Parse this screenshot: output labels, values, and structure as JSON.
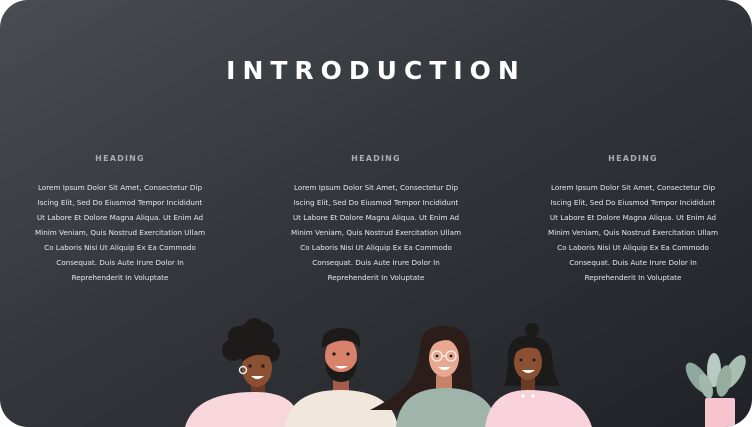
{
  "slide": {
    "title": "INTRODUCTION",
    "columns": [
      {
        "heading": "HEADING",
        "lines": [
          "Lorem Ipsum Dolor Sit Amet, Consectetur Dip",
          "Iscing Elit, Sed Do Eiusmod Tempor Incididunt",
          "Ut Labore Et Dolore Magna Aliqua. Ut Enim Ad",
          "Minim Veniam, Quis Nostrud Exercitation Ullam",
          "Co Laboris Nisi Ut Aliquip Ex Ea Commodo",
          "Consequat. Duis Aute Irure Dolor In",
          "Reprehenderit In Voluptate"
        ]
      },
      {
        "heading": "HEADING",
        "lines": [
          "Lorem Ipsum Dolor Sit Amet, Consectetur Dip",
          "Iscing Elit, Sed Do Eiusmod Tempor Incididunt",
          "Ut Labore Et Dolore Magna Aliqua. Ut Enim Ad",
          "Minim Veniam, Quis Nostrud Exercitation Ullam",
          "Co Laboris Nisi Ut Aliquip Ex Ea Commodo",
          "Consequat. Duis Aute Irure Dolor In",
          "Reprehenderit In Voluptate"
        ]
      },
      {
        "heading": "HEADING",
        "lines": [
          "Lorem Ipsum Dolor Sit Amet, Consectetur Dip",
          "Iscing Elit, Sed Do Eiusmod Tempor Incididunt",
          "Ut Labore Et Dolore Magna Aliqua. Ut Enim Ad",
          "Minim Veniam, Quis Nostrud Exercitation Ullam",
          "Co Laboris Nisi Ut Aliquip Ex Ea Commodo",
          "Consequat. Duis Aute Irure Dolor In",
          "Reprehenderit In Voluptate"
        ]
      }
    ],
    "colors": {
      "background": "#33373c",
      "title": "#ffffff",
      "heading": "#a9acb0",
      "body_text": "#e6e7e8"
    },
    "illustration": {
      "people": [
        "woman-curly-hair-pink-top",
        "man-beard-cream-top",
        "woman-glasses-sage-top",
        "woman-bun-pink-top"
      ],
      "plant": "potted-plant-pink-pot"
    }
  }
}
